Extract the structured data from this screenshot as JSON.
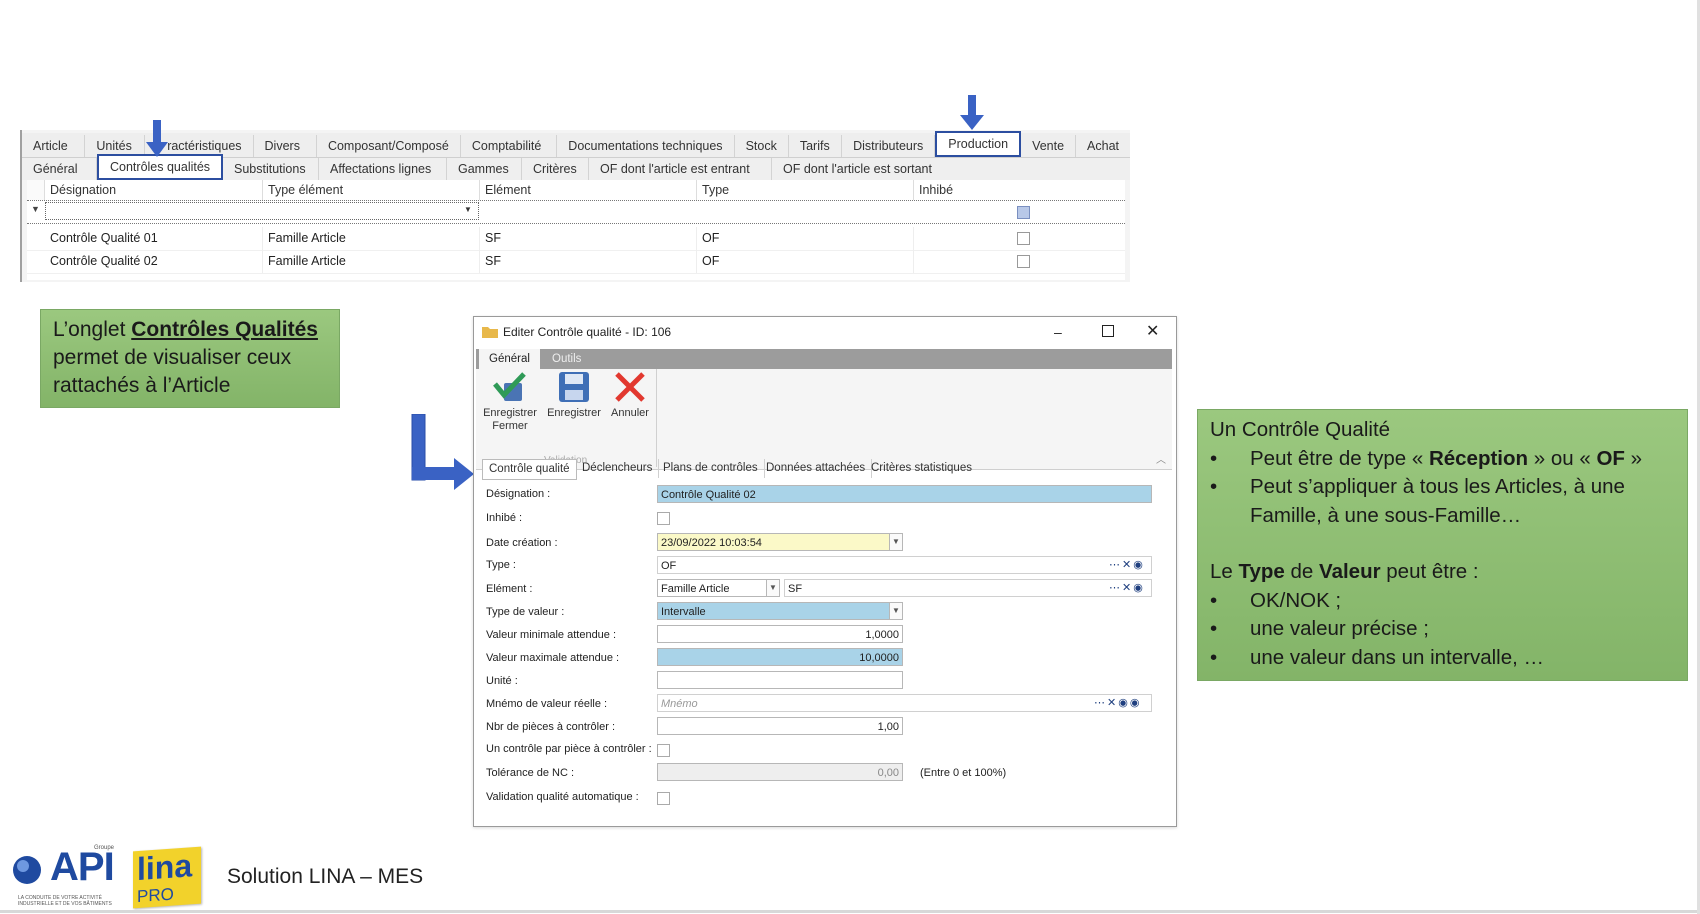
{
  "grid_panel": {
    "main_tabs": [
      "Article",
      "Unités",
      "Caractéristiques",
      "Divers",
      "Composant/Composé",
      "Comptabilité",
      "Documentations techniques",
      "Stock",
      "Tarifs",
      "Distributeurs",
      "Production",
      "Vente",
      "Achat"
    ],
    "main_tabs_visible": [
      "Article",
      "Unités",
      "ractéristiques",
      "Divers",
      "Composant/Composé",
      "Comptabilité",
      "Documentations techniques",
      "Stock",
      "Tarifs",
      "Distributeurs",
      "Production",
      "Vente",
      "Achat"
    ],
    "sub_tabs": [
      "Général",
      "Contrôles qualités",
      "Substitutions",
      "Affectations lignes",
      "Gammes",
      "Critères",
      "OF dont l'article est entrant",
      "OF dont l'article est sortant"
    ],
    "columns": [
      "Désignation",
      "Type élément",
      "Elément",
      "Type",
      "Inhibé"
    ],
    "rows": [
      {
        "designation": "Contrôle Qualité 01",
        "type_element": "Famille Article",
        "element": "SF",
        "type": "OF",
        "inhibe": false
      },
      {
        "designation": "Contrôle Qualité 02",
        "type_element": "Famille Article",
        "element": "SF",
        "type": "OF",
        "inhibe": false
      }
    ]
  },
  "note_left": {
    "prefix": "L’onglet ",
    "bold": "Contrôles Qualités",
    "rest_line1": "permet de visualiser ceux",
    "rest_line2": "rattachés à l’Article"
  },
  "note_right": {
    "title": "Un Contrôle Qualité",
    "b1_a": "Peut être de type « ",
    "b1_b": "Réception",
    "b1_c": " » ou « ",
    "b1_d": "OF",
    "b1_e": " »",
    "b2": "Peut s’appliquer à tous les Articles, à une Famille, à une sous-Famille…",
    "p2_a": "Le ",
    "p2_b": "Type",
    "p2_c": " de ",
    "p2_d": "Valeur",
    "p2_e": " peut être :",
    "items": [
      "OK/NOK ;",
      "une valeur précise ;",
      "une valeur dans un intervalle, …"
    ]
  },
  "dialog": {
    "title": "Editer Contrôle qualité - ID: 106",
    "ribbon_tabs": [
      "Général",
      "Outils"
    ],
    "buttons": {
      "save_close_l1": "Enregistrer",
      "save_close_l2": "Fermer",
      "save": "Enregistrer",
      "cancel": "Annuler"
    },
    "group_label": "Validation",
    "tabs": [
      "Contrôle qualité",
      "Déclencheurs",
      "Plans de contrôles",
      "Données attachées",
      "Critères statistiques"
    ],
    "labels": {
      "designation": "Désignation :",
      "inhibe": "Inhibé :",
      "date": "Date création :",
      "type": "Type :",
      "element": "Elément :",
      "type_valeur": "Type de valeur :",
      "val_min": "Valeur minimale attendue :",
      "val_max": "Valeur maximale attendue :",
      "unite": "Unité :",
      "mnemo": "Mnémo de valeur réelle :",
      "nbr": "Nbr de pièces à contrôler :",
      "un_controle": "Un contrôle par pièce à contrôler :",
      "tolerance": "Tolérance de NC :",
      "validation": "Validation qualité automatique :"
    },
    "values": {
      "designation": "Contrôle Qualité 02",
      "date": "23/09/2022 10:03:54",
      "type": "OF",
      "element_type": "Famille Article",
      "element": "SF",
      "type_valeur": "Intervalle",
      "val_min": "1,0000",
      "val_max": "10,0000",
      "unite": "",
      "mnemo_placeholder": "Mnémo",
      "nbr": "1,00",
      "tolerance": "0,00",
      "tolerance_hint": "(Entre 0 et 100%)"
    }
  },
  "footer": {
    "logo_api": "API",
    "logo_groupe": "Groupe",
    "logo_tagline1": "LA CONDUITE DE VOTRE ACTIVITÉ",
    "logo_tagline2": "INDUSTRIELLE ET DE VOS BÂTIMENTS",
    "logo_lina": "lina",
    "logo_pro": "PRO",
    "solution": "Solution LINA – MES"
  },
  "colors": {
    "accent_blue": "#2c4ea0",
    "arrow_blue": "#3a62c4",
    "note_green": "#8fbf74",
    "field_blue": "#a9d3e8",
    "field_yellow": "#fbf9c8"
  }
}
